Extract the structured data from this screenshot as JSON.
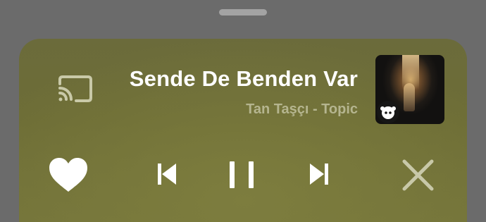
{
  "player": {
    "title": "Sende De Benden Var",
    "artist": "Tan Taşçı - Topic"
  },
  "icons": {
    "cast": "cast-icon",
    "album_art": "album-art",
    "badge": "app-badge-icon",
    "like": "heart-icon",
    "previous": "skip-previous-icon",
    "pause": "pause-icon",
    "next": "skip-next-icon",
    "close": "close-icon"
  },
  "colors": {
    "background": "#6b6b6b",
    "card": "#717139",
    "title": "#ffffff",
    "artist": "#b5b58f",
    "close_icon": "#c8c8a8"
  }
}
